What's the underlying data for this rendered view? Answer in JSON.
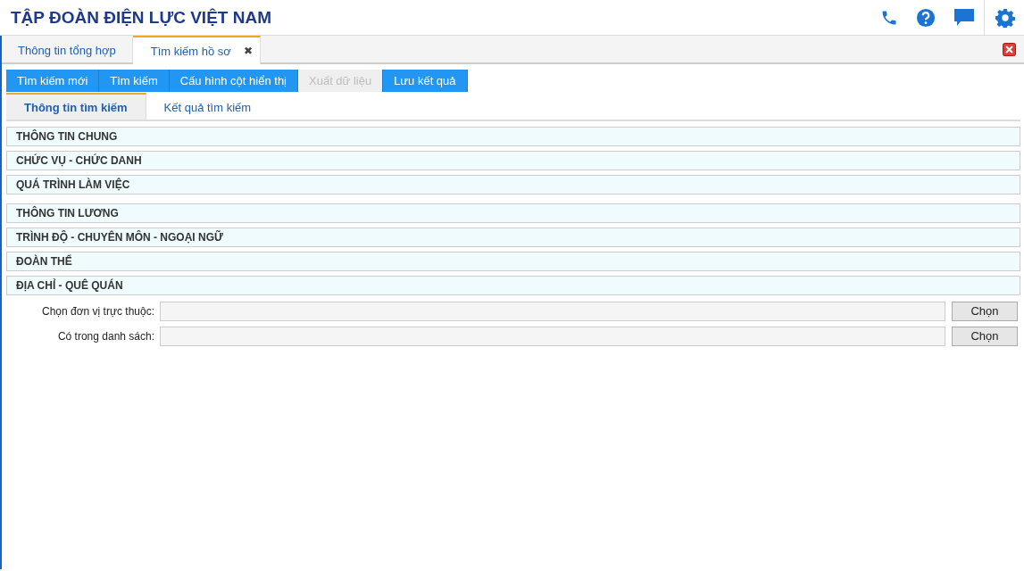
{
  "header": {
    "title": "TẬP ĐOÀN ĐIỆN LỰC VIỆT NAM"
  },
  "tabs": [
    {
      "label": "Thông tin tổng hợp",
      "selected": false
    },
    {
      "label": "Tìm kiếm hồ sơ",
      "selected": true,
      "close_glyph": "✖"
    }
  ],
  "toolbar": [
    {
      "label": "Tìm kiếm mới",
      "disabled": false
    },
    {
      "label": "Tìm kiếm",
      "disabled": false
    },
    {
      "label": "Cấu hình cột hiển thị",
      "disabled": false
    },
    {
      "label": "Xuất dữ liệu",
      "disabled": true
    },
    {
      "label": "Lưu kết quả",
      "disabled": false
    }
  ],
  "subtabs": [
    {
      "label": "Thông tin tìm kiếm",
      "selected": true
    },
    {
      "label": "Kết quả tìm kiếm",
      "selected": false
    }
  ],
  "sections": [
    {
      "title": "THÔNG TIN CHUNG"
    },
    {
      "title": "CHỨC VỤ - CHỨC DANH"
    },
    {
      "title": "QUÁ TRÌNH LÀM VIỆC"
    },
    {
      "title": "THÔNG TIN LƯƠNG"
    },
    {
      "title": "TRÌNH ĐỘ - CHUYÊN MÔN - NGOẠI NGỮ"
    },
    {
      "title": "ĐOÀN THỂ"
    },
    {
      "title": "ĐỊA CHỈ - QUÊ QUÁN",
      "fields": [
        {
          "label": "Chọn đơn vị trực thuộc:",
          "button": "Chọn"
        },
        {
          "label": "Có trong danh sách:",
          "button": "Chọn"
        }
      ]
    }
  ]
}
